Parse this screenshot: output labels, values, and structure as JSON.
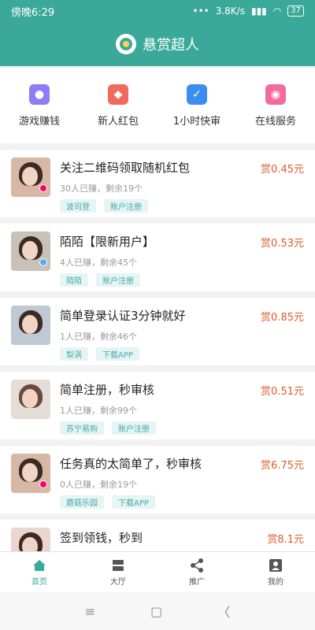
{
  "status": {
    "time": "傍晚6:29",
    "speed": "3.8K/s",
    "battery": "37"
  },
  "app": {
    "title": "悬赏超人"
  },
  "quick_actions": [
    {
      "label": "游戏赚钱",
      "icon": "gamepad-icon",
      "color": "#8e7cf6"
    },
    {
      "label": "新人红包",
      "icon": "red-envelope-icon",
      "color": "#f26a5d"
    },
    {
      "label": "1小时快审",
      "icon": "clipboard-check-icon",
      "color": "#3b8ef0"
    },
    {
      "label": "在线服务",
      "icon": "headset-icon",
      "color": "#f36aa0"
    }
  ],
  "tasks": [
    {
      "title": "关注二维码领取随机红包",
      "meta": "30人已赚，剩余19个",
      "reward": "赏0.45元",
      "tags": [
        "波司登",
        "账户注册"
      ]
    },
    {
      "title": "陌陌【限新用户】",
      "meta": "4人已赚，剩余45个",
      "reward": "赏0.53元",
      "tags": [
        "陌陌",
        "账户注册"
      ]
    },
    {
      "title": "简单登录认证3分钟就好",
      "meta": "1人已赚，剩余46个",
      "reward": "赏0.85元",
      "tags": [
        "梨涡",
        "下载APP"
      ]
    },
    {
      "title": "简单注册，秒审核",
      "meta": "1人已赚，剩余99个",
      "reward": "赏0.51元",
      "tags": [
        "苏宁易购",
        "账户注册"
      ]
    },
    {
      "title": "任务真的太简单了，秒审核",
      "meta": "0人已赚，剩余19个",
      "reward": "赏6.75元",
      "tags": [
        "蘑菇乐园",
        "下载APP"
      ]
    },
    {
      "title": "签到领钱，秒到",
      "meta": "",
      "reward": "赏8.1元",
      "tags": []
    }
  ],
  "tabbar": [
    {
      "label": "首页",
      "icon": "home-icon",
      "active": true
    },
    {
      "label": "大厅",
      "icon": "hall-icon",
      "active": false
    },
    {
      "label": "推广",
      "icon": "share-icon",
      "active": false
    },
    {
      "label": "我的",
      "icon": "profile-icon",
      "active": false
    }
  ],
  "system_nav": {
    "menu": "≡",
    "home": "▢",
    "back": "〈"
  }
}
